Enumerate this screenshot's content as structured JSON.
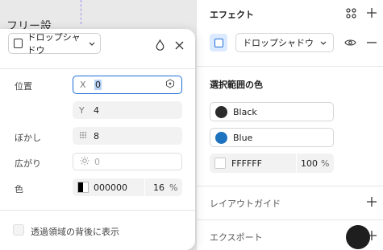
{
  "canvas": {
    "text": "フリー設"
  },
  "popup": {
    "effect_type": "ドロップシャドウ",
    "fields": {
      "position_label": "位置",
      "x_prefix": "X",
      "x_value": "0",
      "y_prefix": "Y",
      "y_value": "4",
      "blur_label": "ぼかし",
      "blur_value": "8",
      "spread_label": "広がり",
      "spread_placeholder": "0",
      "color_label": "色",
      "color_hex": "000000",
      "color_opacity": "16",
      "percent": "%"
    },
    "checkbox_label": "透過領域の背後に表示"
  },
  "panel": {
    "effects": {
      "title": "エフェクト",
      "effect_select": "ドロップシャドウ"
    },
    "selection_colors": {
      "title": "選択範囲の色",
      "colors": [
        {
          "name": "Black",
          "color": "#2b2b2b"
        },
        {
          "name": "Blue",
          "color": "#1e73be"
        }
      ],
      "hex": "FFFFFF",
      "opacity": "100",
      "percent": "%"
    },
    "layout_guide": {
      "title": "レイアウトガイド"
    },
    "export": {
      "title": "エクスポート"
    }
  }
}
